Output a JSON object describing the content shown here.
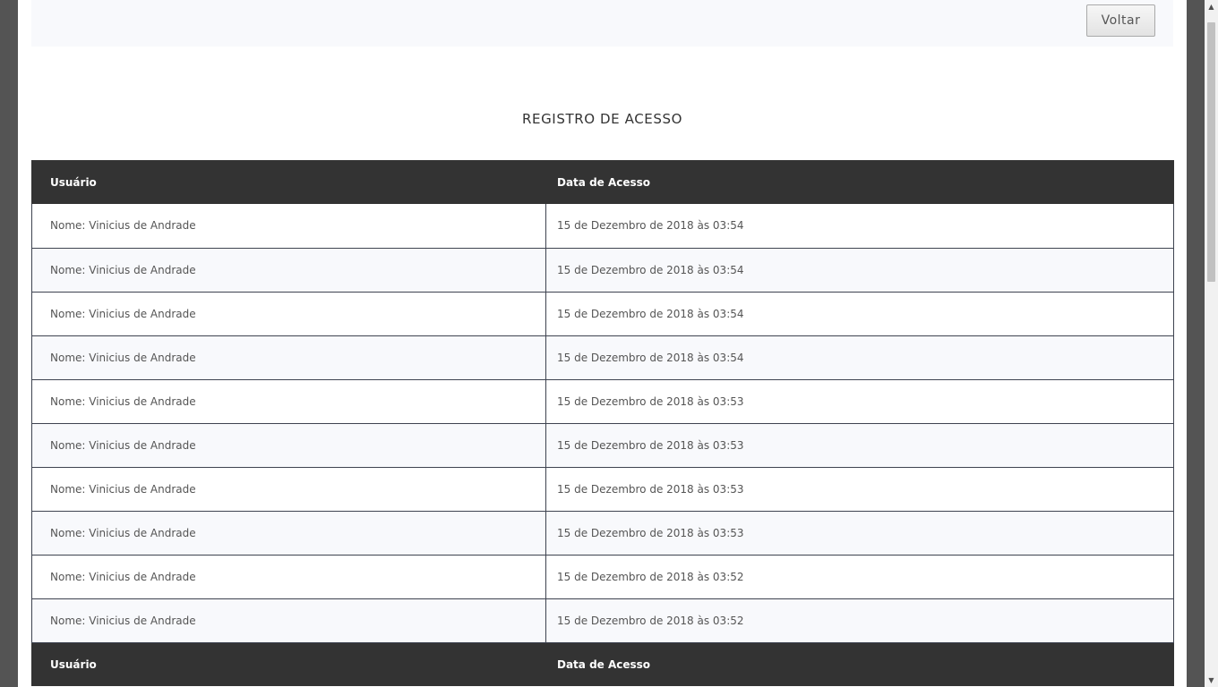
{
  "top_bar": {
    "back_button_label": "Voltar"
  },
  "section_title": "REGISTRO DE ACESSO",
  "table": {
    "columns": [
      "Usuário",
      "Data de Acesso"
    ],
    "rows": [
      {
        "user": "Nome: Vinicius de Andrade",
        "date": "15 de Dezembro de 2018 às 03:54"
      },
      {
        "user": "Nome: Vinicius de Andrade",
        "date": "15 de Dezembro de 2018 às 03:54"
      },
      {
        "user": "Nome: Vinicius de Andrade",
        "date": "15 de Dezembro de 2018 às 03:54"
      },
      {
        "user": "Nome: Vinicius de Andrade",
        "date": "15 de Dezembro de 2018 às 03:54"
      },
      {
        "user": "Nome: Vinicius de Andrade",
        "date": "15 de Dezembro de 2018 às 03:53"
      },
      {
        "user": "Nome: Vinicius de Andrade",
        "date": "15 de Dezembro de 2018 às 03:53"
      },
      {
        "user": "Nome: Vinicius de Andrade",
        "date": "15 de Dezembro de 2018 às 03:53"
      },
      {
        "user": "Nome: Vinicius de Andrade",
        "date": "15 de Dezembro de 2018 às 03:53"
      },
      {
        "user": "Nome: Vinicius de Andrade",
        "date": "15 de Dezembro de 2018 às 03:52"
      },
      {
        "user": "Nome: Vinicius de Andrade",
        "date": "15 de Dezembro de 2018 às 03:52"
      }
    ],
    "footer_columns": [
      "Usuário",
      "Data de Acesso"
    ]
  },
  "scrollbar": {
    "up_arrow_icon": "triangle-up-icon",
    "down_arrow_icon": "triangle-down-icon",
    "up_glyph": "▲",
    "down_glyph": "▼"
  },
  "colors": {
    "header_bg": "#333333",
    "row_alt_bg": "#f8f9fc",
    "border": "#3e4350"
  }
}
